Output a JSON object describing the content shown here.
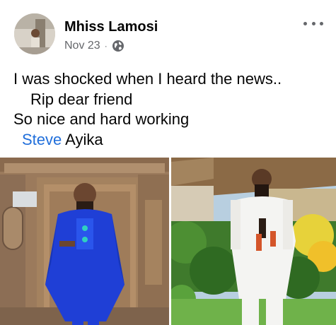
{
  "post": {
    "author": "Mhiss Lamosi",
    "date": "Nov 23",
    "separator": "·",
    "privacy_icon": "globe-icon",
    "more_icon": "more-options-icon",
    "text": {
      "line1": "I was shocked when I heard the news..",
      "line2": "Rip dear friend",
      "line3": "So nice and hard working",
      "mention_first": "Steve",
      "mention_last": "Ayika"
    },
    "photos": [
      "photo-man-in-blue-agbada",
      "photo-man-in-white-outfit"
    ]
  },
  "colors": {
    "text": "#050505",
    "secondary": "#65676b",
    "link": "#216fdb",
    "blue_outfit": "#1f3fd6",
    "white_outfit": "#f4f4f2"
  }
}
